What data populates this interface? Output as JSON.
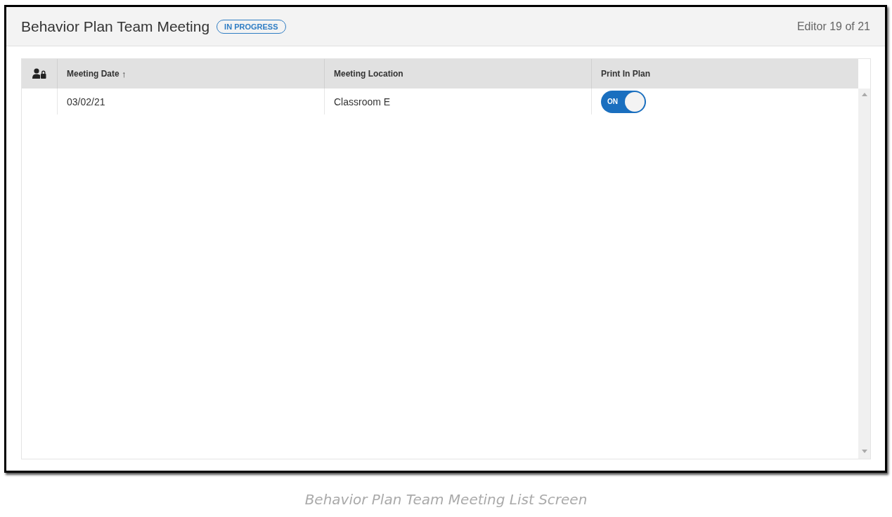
{
  "header": {
    "title": "Behavior Plan Team Meeting",
    "status_badge": "IN PROGRESS",
    "record_position": "Editor 19 of 21"
  },
  "table": {
    "columns": [
      {
        "kind": "icon"
      },
      {
        "kind": "text",
        "label": "Meeting Date",
        "sort_indicator": "↑"
      },
      {
        "kind": "text",
        "label": "Meeting Location"
      },
      {
        "kind": "text",
        "label": "Print In Plan"
      }
    ],
    "rows": [
      {
        "meeting_date": "03/02/21",
        "meeting_location": "Classroom E",
        "print_in_plan": {
          "on": true,
          "label": "ON"
        }
      }
    ]
  },
  "caption": "Behavior Plan Team Meeting List Screen"
}
